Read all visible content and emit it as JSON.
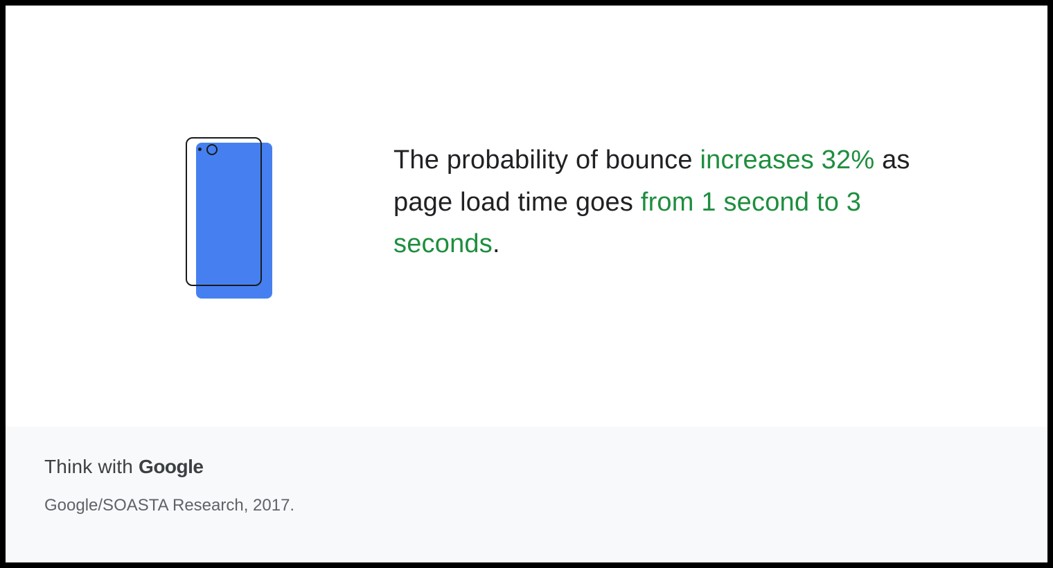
{
  "statistic": {
    "part1": "The probability of bounce ",
    "highlight1": "increases 32%",
    "part2": " as page load time goes ",
    "highlight2": "from 1 second to 3 seconds",
    "part3": "."
  },
  "footer": {
    "brand_prefix": "Think with ",
    "brand_name": "Google",
    "source": "Google/SOASTA Research, 2017."
  },
  "colors": {
    "highlight": "#1e8e3e",
    "phone_fill": "#4680f0",
    "footer_bg": "#f8f9fa"
  }
}
